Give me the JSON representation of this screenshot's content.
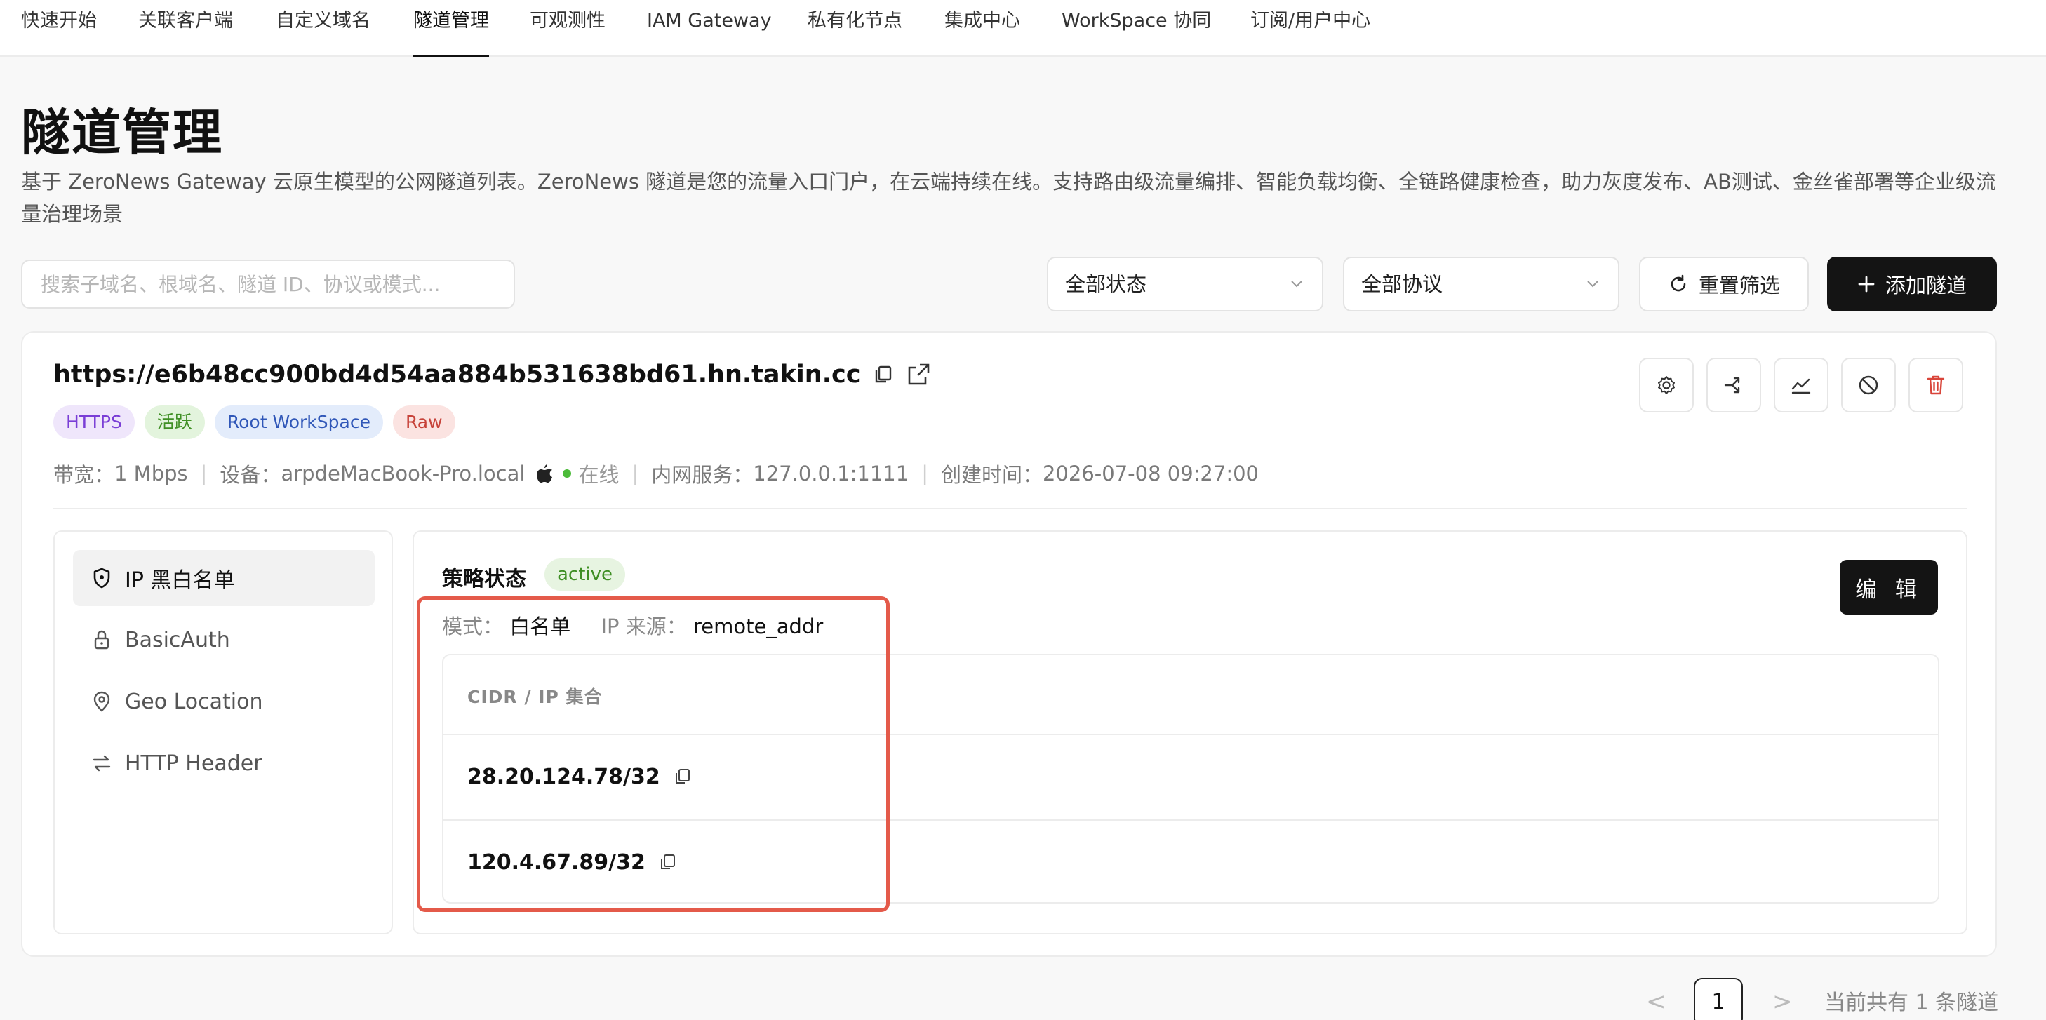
{
  "nav": {
    "tabs": [
      {
        "label": "快速开始"
      },
      {
        "label": "关联客户端"
      },
      {
        "label": "自定义域名"
      },
      {
        "label": "隧道管理"
      },
      {
        "label": "可观测性"
      },
      {
        "label": "IAM Gateway"
      },
      {
        "label": "私有化节点"
      },
      {
        "label": "集成中心"
      },
      {
        "label": "WorkSpace 协同"
      },
      {
        "label": "订阅/用户中心"
      }
    ],
    "active_tab": "隧道管理"
  },
  "header": {
    "title": "隧道管理",
    "description": "基于 ZeroNews Gateway 云原生模型的公网隧道列表。ZeroNews 隧道是您的流量入口门户，在云端持续在线。支持路由级流量编排、智能负载均衡、全链路健康检查，助力灰度发布、AB测试、金丝雀部署等企业级流量治理场景"
  },
  "filters": {
    "search_placeholder": "搜索子域名、根域名、隧道 ID、协议或模式...",
    "status_select": "全部状态",
    "protocol_select": "全部协议",
    "reset_label": "重置筛选",
    "add_label": "添加隧道"
  },
  "tunnel": {
    "url": "https://e6b48cc900bd4d54aa884b531638bd61.hn.takin.cc",
    "tags": {
      "protocol": "HTTPS",
      "state": "活跃",
      "workspace": "Root WorkSpace",
      "mode": "Raw"
    },
    "meta": {
      "bandwidth_label": "带宽：",
      "bandwidth_value": "1 Mbps",
      "device_label": "设备：",
      "device_value": "arpdeMacBook-Pro.local",
      "online_text": "在线",
      "service_label": "内网服务：",
      "service_value": "127.0.0.1:1111",
      "created_label": "创建时间：",
      "created_value": "2026-07-08 09:27:00"
    },
    "actions": [
      "gear-icon",
      "share-icon",
      "chart-icon",
      "ban-icon",
      "trash-icon"
    ]
  },
  "side_menu": {
    "items": [
      {
        "label": "IP 黑白名单",
        "icon": "shield-icon"
      },
      {
        "label": "BasicAuth",
        "icon": "lock-icon"
      },
      {
        "label": "Geo Location",
        "icon": "location-pin-icon"
      },
      {
        "label": "HTTP Header",
        "icon": "swap-arrows-icon"
      }
    ],
    "selected": "IP 黑白名单"
  },
  "policy": {
    "title": "策略状态",
    "status": "active",
    "mode_label": "模式：",
    "mode_value": "白名单",
    "ip_source_label": "IP 来源：",
    "ip_source_value": "remote_addr",
    "edit_label": "编 辑",
    "table_header": "CIDR / IP 集合",
    "cidrs": [
      "28.20.124.78/32",
      "120.4.67.89/32"
    ]
  },
  "pagination": {
    "prev": "<",
    "current_page": "1",
    "next": ">",
    "total_text": "当前共有 1 条隧道"
  },
  "colors": {
    "primary": "#141414",
    "highlight_border": "#e45a4a",
    "online_green": "#4cbb3a",
    "danger_red": "#d9453a"
  }
}
